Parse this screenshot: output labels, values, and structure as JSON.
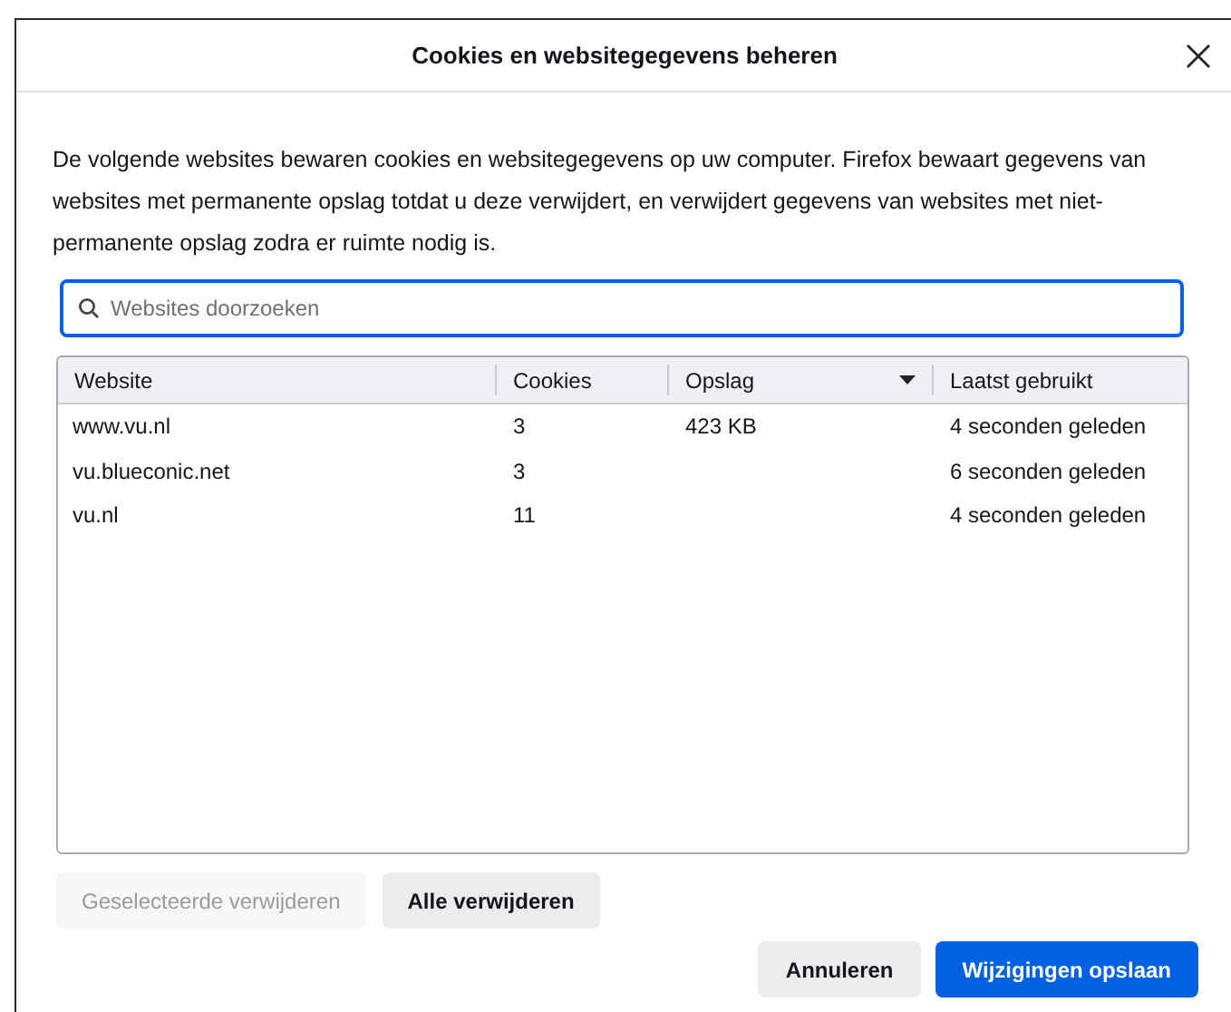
{
  "dialog": {
    "title": "Cookies en websitegegevens beheren"
  },
  "description": "De volgende websites bewaren cookies en websitegegevens op uw computer. Firefox bewaart gegevens van websites met permanente opslag totdat u deze verwijdert, en verwijdert gegevens van websites met niet-permanente opslag zodra er ruimte nodig is.",
  "search": {
    "placeholder": "Websites doorzoeken"
  },
  "table": {
    "columns": [
      {
        "label": "Website",
        "sorted": false
      },
      {
        "label": "Cookies",
        "sorted": false
      },
      {
        "label": "Opslag",
        "sorted": true
      },
      {
        "label": "Laatst gebruikt",
        "sorted": false
      }
    ],
    "rows": [
      [
        "www.vu.nl",
        "3",
        "423 KB",
        "4 seconden geleden"
      ],
      [
        "vu.blueconic.net",
        "3",
        "",
        "6 seconden geleden"
      ],
      [
        "vu.nl",
        "11",
        "",
        "4 seconden geleden"
      ]
    ]
  },
  "list_buttons": [
    {
      "label": "Geselecteerde verwijderen",
      "disabled": true
    },
    {
      "label": "Alle verwijderen",
      "disabled": false
    }
  ],
  "footer_buttons": [
    {
      "label": "Annuleren",
      "kind": "secondary"
    },
    {
      "label": "Wijzigingen opslaan",
      "kind": "primary"
    }
  ]
}
